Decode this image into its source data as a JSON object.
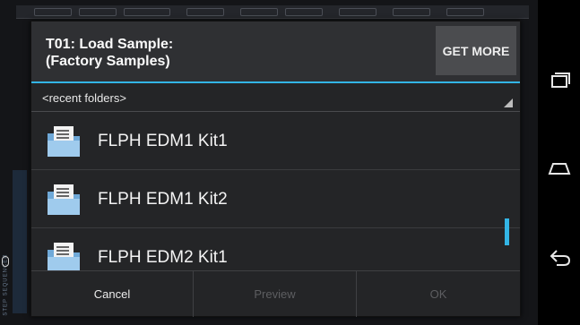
{
  "dialog": {
    "title_line1": "T01: Load Sample:",
    "title_line2": "(Factory Samples)",
    "get_more_label": "GET MORE",
    "folder_selector_label": "<recent folders>",
    "items": [
      {
        "name": "FLPH EDM1 Kit1",
        "icon": "folder-icon"
      },
      {
        "name": "FLPH EDM1 Kit2",
        "icon": "folder-icon"
      },
      {
        "name": "FLPH EDM2 Kit1",
        "icon": "folder-icon"
      }
    ],
    "buttons": {
      "cancel": "Cancel",
      "preview": "Preview",
      "ok": "OK"
    }
  },
  "navbar": {
    "icons": [
      "recent-apps-icon",
      "home-icon",
      "back-icon"
    ]
  },
  "colors": {
    "accent": "#33b5e5",
    "dialog_bg": "#242527",
    "title_bg": "#2f3033"
  }
}
